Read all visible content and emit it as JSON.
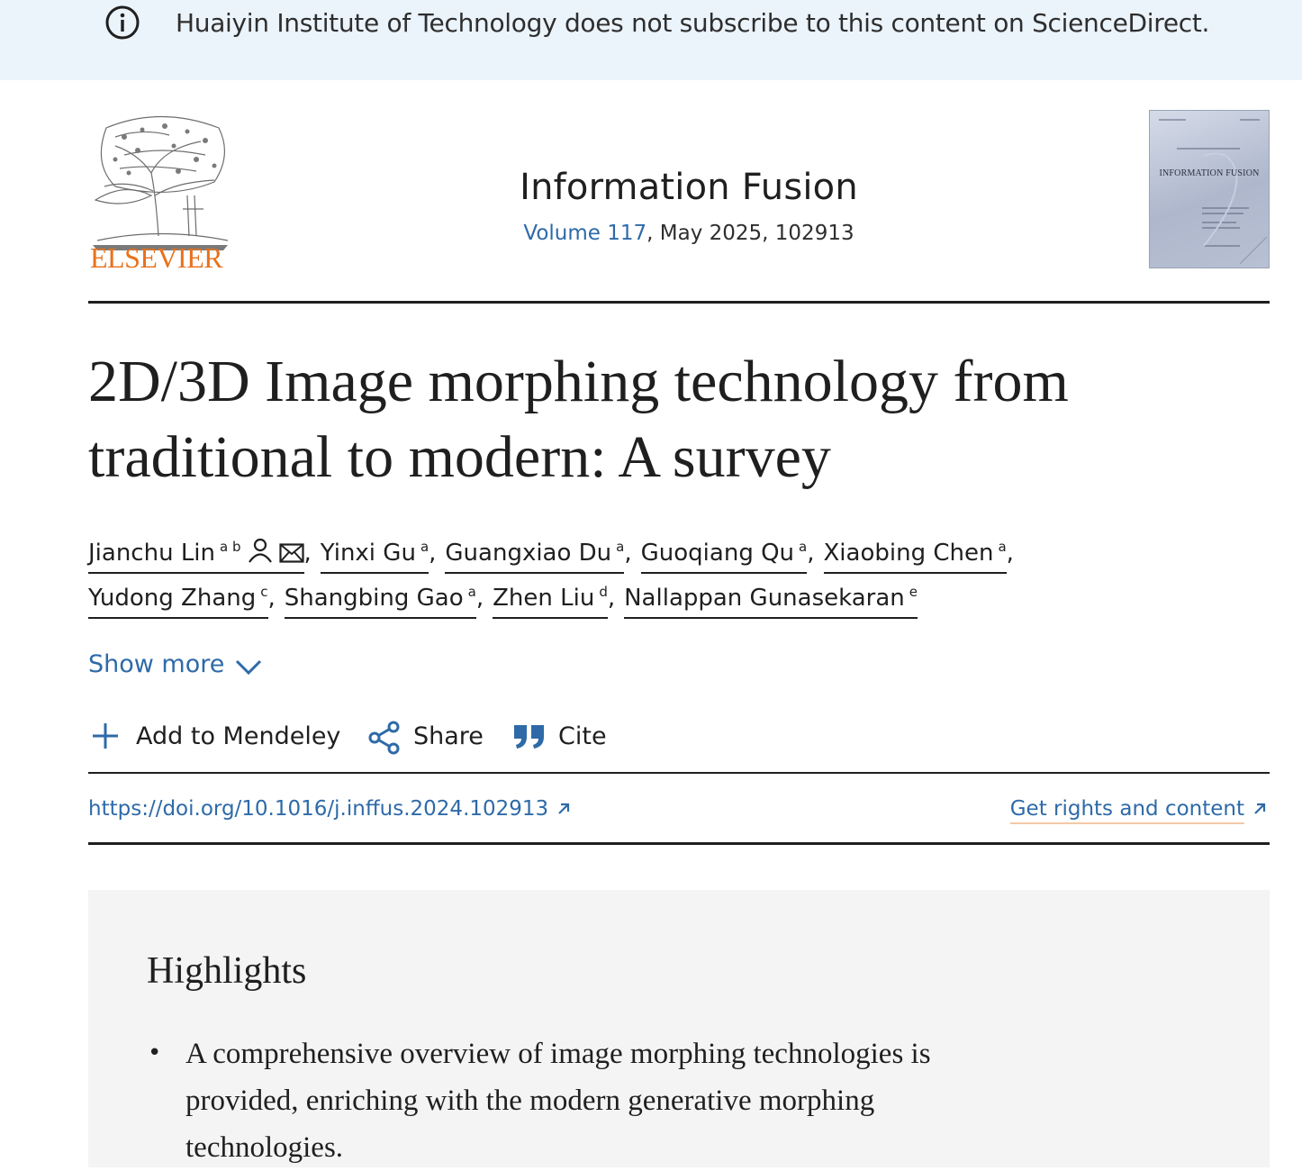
{
  "banner": {
    "message": "Huaiyin Institute of Technology does not subscribe to this content on ScienceDirect.",
    "icon": "info-icon"
  },
  "publisher": {
    "logo_text": "ELSEVIER",
    "logo_color": "#e9711c"
  },
  "journal": {
    "name": "Information Fusion",
    "volume_link": "Volume 117",
    "issue_info": ", May 2025, 102913",
    "cover_title": "INFORMATION FUSION"
  },
  "article": {
    "title": "2D/3D Image morphing technology from traditional to modern: A survey"
  },
  "authors": [
    {
      "name": "Jianchu Lin",
      "affil": "a b",
      "icons": [
        "person-icon",
        "email-icon"
      ]
    },
    {
      "name": "Yinxi Gu",
      "affil": "a"
    },
    {
      "name": "Guangxiao Du",
      "affil": "a"
    },
    {
      "name": "Guoqiang Qu",
      "affil": "a"
    },
    {
      "name": "Xiaobing Chen",
      "affil": "a"
    },
    {
      "name": "Yudong Zhang",
      "affil": "c"
    },
    {
      "name": "Shangbing Gao",
      "affil": "a"
    },
    {
      "name": "Zhen Liu",
      "affil": "d"
    },
    {
      "name": "Nallappan Gunasekaran",
      "affil": "e"
    }
  ],
  "show_more": "Show more",
  "actions": {
    "mendeley": "Add to Mendeley",
    "share": "Share",
    "cite": "Cite"
  },
  "doi": "https://doi.org/10.1016/j.inffus.2024.102913",
  "rights": "Get rights and content",
  "highlights": {
    "heading": "Highlights",
    "items": [
      "A comprehensive overview of image morphing technologies is provided, enriching with the modern generative morphing technologies."
    ]
  },
  "colors": {
    "link": "#2e6aa8",
    "banner_bg": "#ebf3fb",
    "highlights_bg": "#f4f4f4"
  }
}
